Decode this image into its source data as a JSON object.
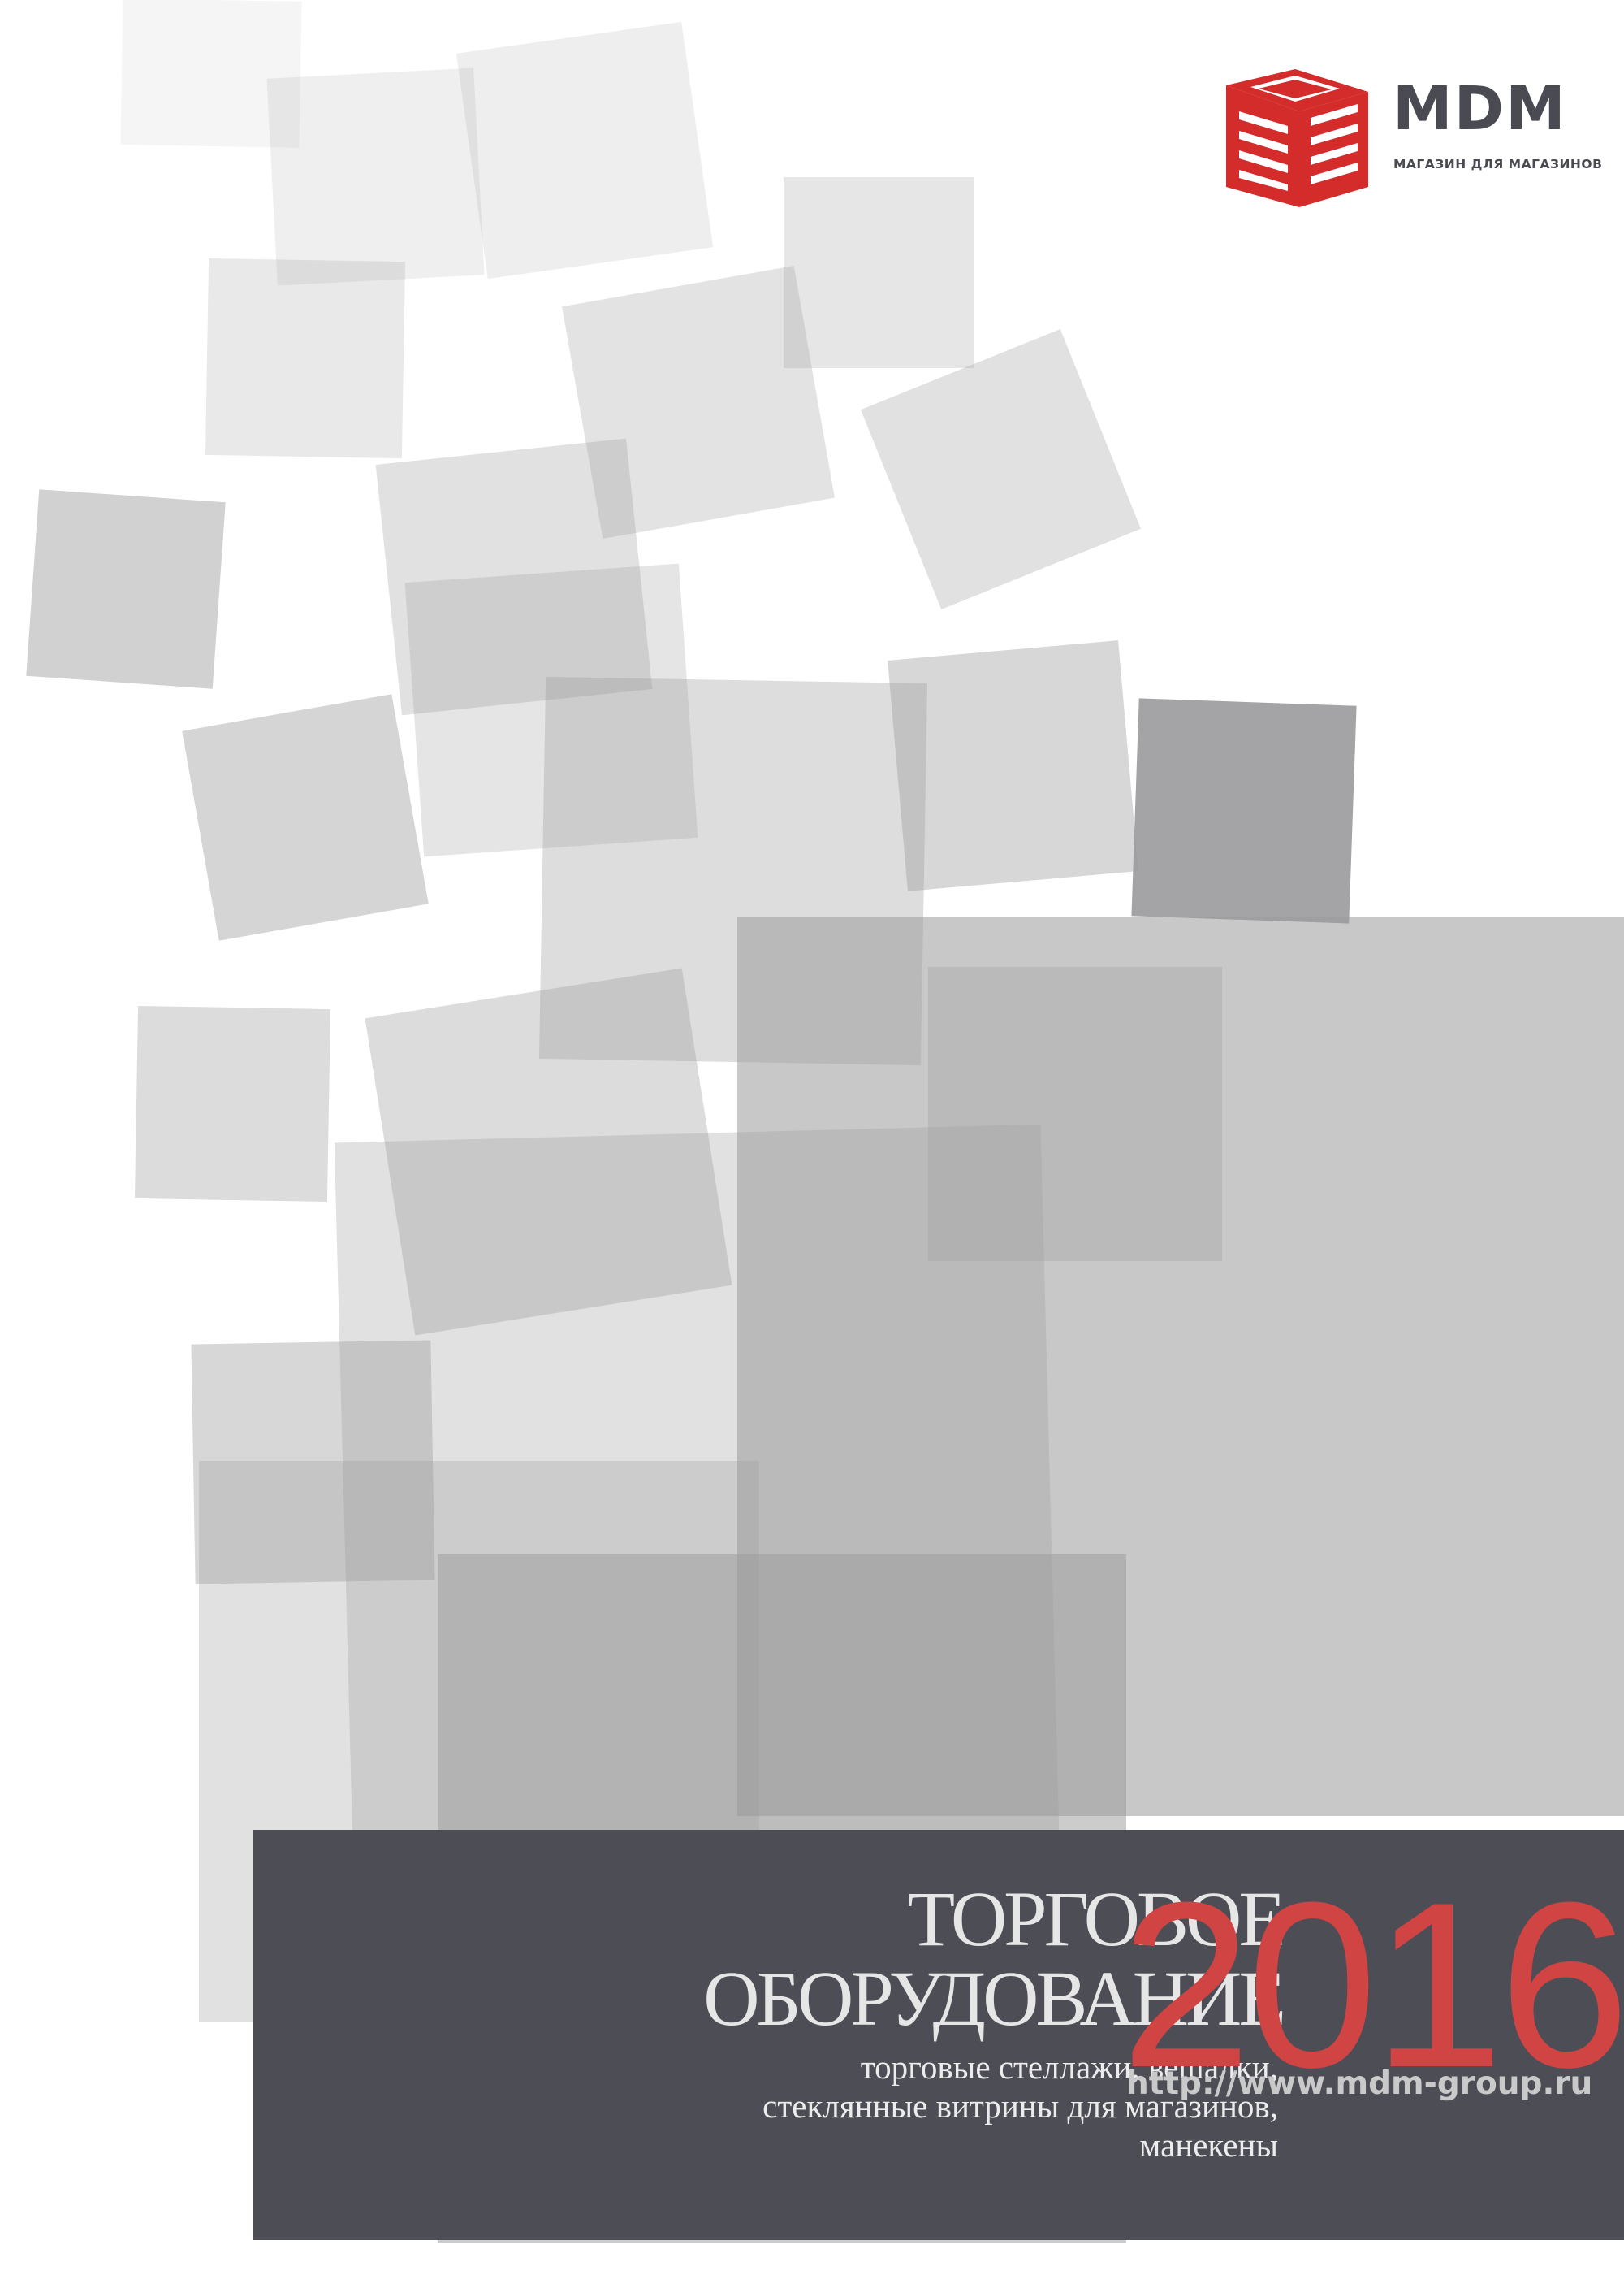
{
  "logo": {
    "name": "MDM",
    "tagline": "МАГАЗИН ДЛЯ МАГАЗИНОВ",
    "icon": "mdm-cube-logo",
    "color": "#d42b2b"
  },
  "cover": {
    "title_line1": "ТОРГОВОЕ",
    "title_line2": "ОБОРУДОВАНИЕ",
    "subtitle": "торговые стеллажи, вешалки,\nстеклянные витрины для магазинов,\nманекены",
    "year": "2016",
    "url": "http://www.mdm-group.ru"
  },
  "colors": {
    "panel": "#4d4d55",
    "year": "#d14444",
    "squares_grey": "#9a9a9c"
  }
}
